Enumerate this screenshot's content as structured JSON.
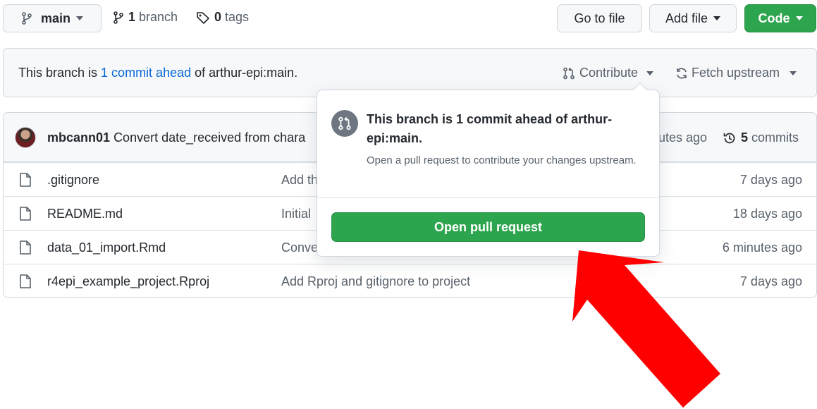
{
  "top_bar": {
    "branch_select_label": "main",
    "branches_count": "1",
    "branches_label": "branch",
    "tags_count": "0",
    "tags_label": "tags",
    "go_to_file_label": "Go to file",
    "add_file_label": "Add file",
    "code_label": "Code"
  },
  "banner": {
    "prefix": "This branch is ",
    "link_text": "1 commit ahead",
    "suffix": " of arthur-epi:main.",
    "contribute_label": "Contribute",
    "fetch_upstream_label": "Fetch upstream"
  },
  "latest_commit": {
    "author": "mbcann01",
    "message": "Convert date_received from chara",
    "time_partial": "utes ago",
    "commits_count": "5",
    "commits_label": "commits"
  },
  "files": [
    {
      "name": ".gitignore",
      "message": "Add th",
      "age": "7 days ago"
    },
    {
      "name": "README.md",
      "message": "Initial",
      "age": "18 days ago"
    },
    {
      "name": "data_01_import.Rmd",
      "message": "Conve",
      "age": "6 minutes ago"
    },
    {
      "name": "r4epi_example_project.Rproj",
      "message": "Add Rproj and gitignore to project",
      "age": "7 days ago"
    }
  ],
  "popover": {
    "title": "This branch is 1 commit ahead of arthur-epi:main.",
    "description": "Open a pull request to contribute your changes upstream.",
    "button_label": "Open pull request"
  },
  "colors": {
    "accent_green": "#2da44e",
    "link_blue": "#0969da",
    "annotation_red": "#ff0000"
  },
  "icons": [
    "branch-icon",
    "git-branch-icon",
    "tag-icon",
    "pull-request-icon",
    "sync-icon",
    "history-icon",
    "file-icon"
  ]
}
